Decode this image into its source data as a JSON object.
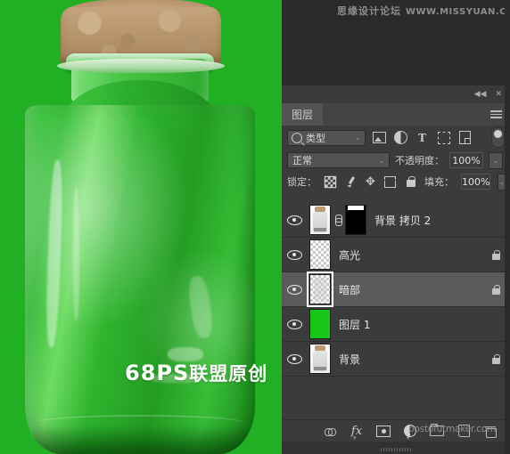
{
  "canvas": {
    "watermark_text": "68PS",
    "watermark_cn": "联盟原创",
    "background_color": "#21b024",
    "subject": "glass-jar-with-cork"
  },
  "site_watermark": {
    "forum_name": "思缘设计论坛",
    "url": "WWW.MISSYUAN.COM"
  },
  "panel": {
    "collapse_icon": "◀◀",
    "close_icon": "✕",
    "tab_label": "图层",
    "menu_icon": "panel-menu-icon"
  },
  "filter_row": {
    "search_icon": "search-icon",
    "type_label": "类型",
    "caret": "⌄",
    "icons": [
      {
        "name": "filter-pixel-layers-icon",
        "label": "图像"
      },
      {
        "name": "filter-adjustment-layers-icon",
        "label": "调整"
      },
      {
        "name": "filter-type-layers-icon",
        "label": "T"
      },
      {
        "name": "filter-shape-layers-icon",
        "label": "形状"
      },
      {
        "name": "filter-smart-object-icon",
        "label": "智能对象"
      }
    ],
    "toggle_name": "filter-enable-toggle"
  },
  "blend_row": {
    "blend_mode": "正常",
    "caret": "⌄",
    "opacity_label": "不透明度：",
    "opacity_value": "100%",
    "opacity_stepper": "⌄"
  },
  "lock_row": {
    "lock_label": "锁定：",
    "items": [
      {
        "name": "lock-transparent-pixels-icon",
        "active": true
      },
      {
        "name": "lock-image-pixels-brush-icon",
        "active": false
      },
      {
        "name": "lock-position-move-icon",
        "active": false
      },
      {
        "name": "lock-artboard-nesting-icon",
        "active": false
      },
      {
        "name": "lock-all-icon",
        "active": false
      }
    ],
    "fill_label": "填充：",
    "fill_value": "100%",
    "fill_stepper": "⌄"
  },
  "layers": [
    {
      "name": "背景 拷贝 2",
      "visible": true,
      "selected": false,
      "locked": false,
      "thumb": "bottle",
      "has_mask": true,
      "linked": true
    },
    {
      "name": "高光",
      "visible": true,
      "selected": false,
      "locked": true,
      "thumb": "transparent",
      "has_mask": false,
      "linked": false
    },
    {
      "name": "暗部",
      "visible": true,
      "selected": true,
      "locked": true,
      "thumb": "transparent-bottle",
      "has_mask": false,
      "linked": false
    },
    {
      "name": "图层 1",
      "visible": true,
      "selected": false,
      "locked": false,
      "thumb": "green",
      "has_mask": false,
      "linked": false
    },
    {
      "name": "背景",
      "visible": true,
      "selected": false,
      "locked": true,
      "thumb": "bottle",
      "has_mask": false,
      "linked": false
    }
  ],
  "footer": {
    "buttons": [
      {
        "name": "link-layers-button",
        "label": "链接图层"
      },
      {
        "name": "layer-style-fx-button",
        "label": "fx"
      },
      {
        "name": "add-layer-mask-button",
        "label": "添加图层蒙版"
      },
      {
        "name": "new-fill-adjustment-layer-button",
        "label": "新建调整图层"
      },
      {
        "name": "new-group-button",
        "label": "创建新组"
      },
      {
        "name": "new-layer-button",
        "label": "创建新图层"
      },
      {
        "name": "delete-layer-button",
        "label": "删除图层"
      }
    ],
    "watermark": "postofutmaker.com"
  }
}
